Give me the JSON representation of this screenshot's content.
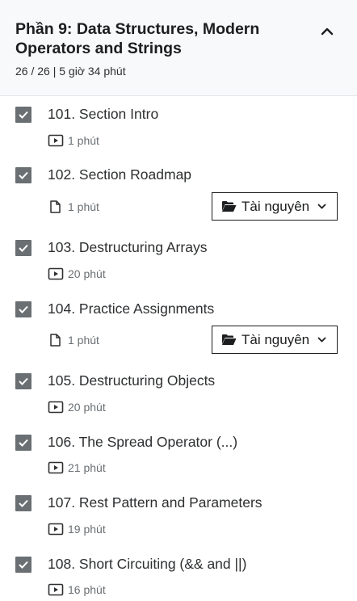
{
  "section": {
    "title": "Phần 9: Data Structures, Modern Operators and Strings",
    "meta": "26 / 26 | 5 giờ 34 phút"
  },
  "colors": {
    "checkbox": "#6a6f73",
    "header_bg": "#f7f9fa",
    "text": "#1c1d1f"
  },
  "lectures": [
    {
      "title": "101. Section Intro",
      "duration": "1 phút",
      "icon": "video-icon",
      "completed": true
    },
    {
      "title": "102. Section Roadmap",
      "duration": "1 phút",
      "icon": "file-icon",
      "completed": true,
      "resources_label": "Tài nguyên"
    },
    {
      "title": "103. Destructuring Arrays",
      "duration": "20 phút",
      "icon": "video-icon",
      "completed": true
    },
    {
      "title": "104. Practice Assignments",
      "duration": "1 phút",
      "icon": "file-icon",
      "completed": true,
      "resources_label": "Tài nguyên"
    },
    {
      "title": "105. Destructuring Objects",
      "duration": "20 phút",
      "icon": "video-icon",
      "completed": true
    },
    {
      "title": "106. The Spread Operator (...)",
      "duration": "21 phút",
      "icon": "video-icon",
      "completed": true
    },
    {
      "title": "107. Rest Pattern and Parameters",
      "duration": "19 phút",
      "icon": "video-icon",
      "completed": true
    },
    {
      "title": "108. Short Circuiting (&& and ||)",
      "duration": "16 phút",
      "icon": "video-icon",
      "completed": true
    }
  ]
}
